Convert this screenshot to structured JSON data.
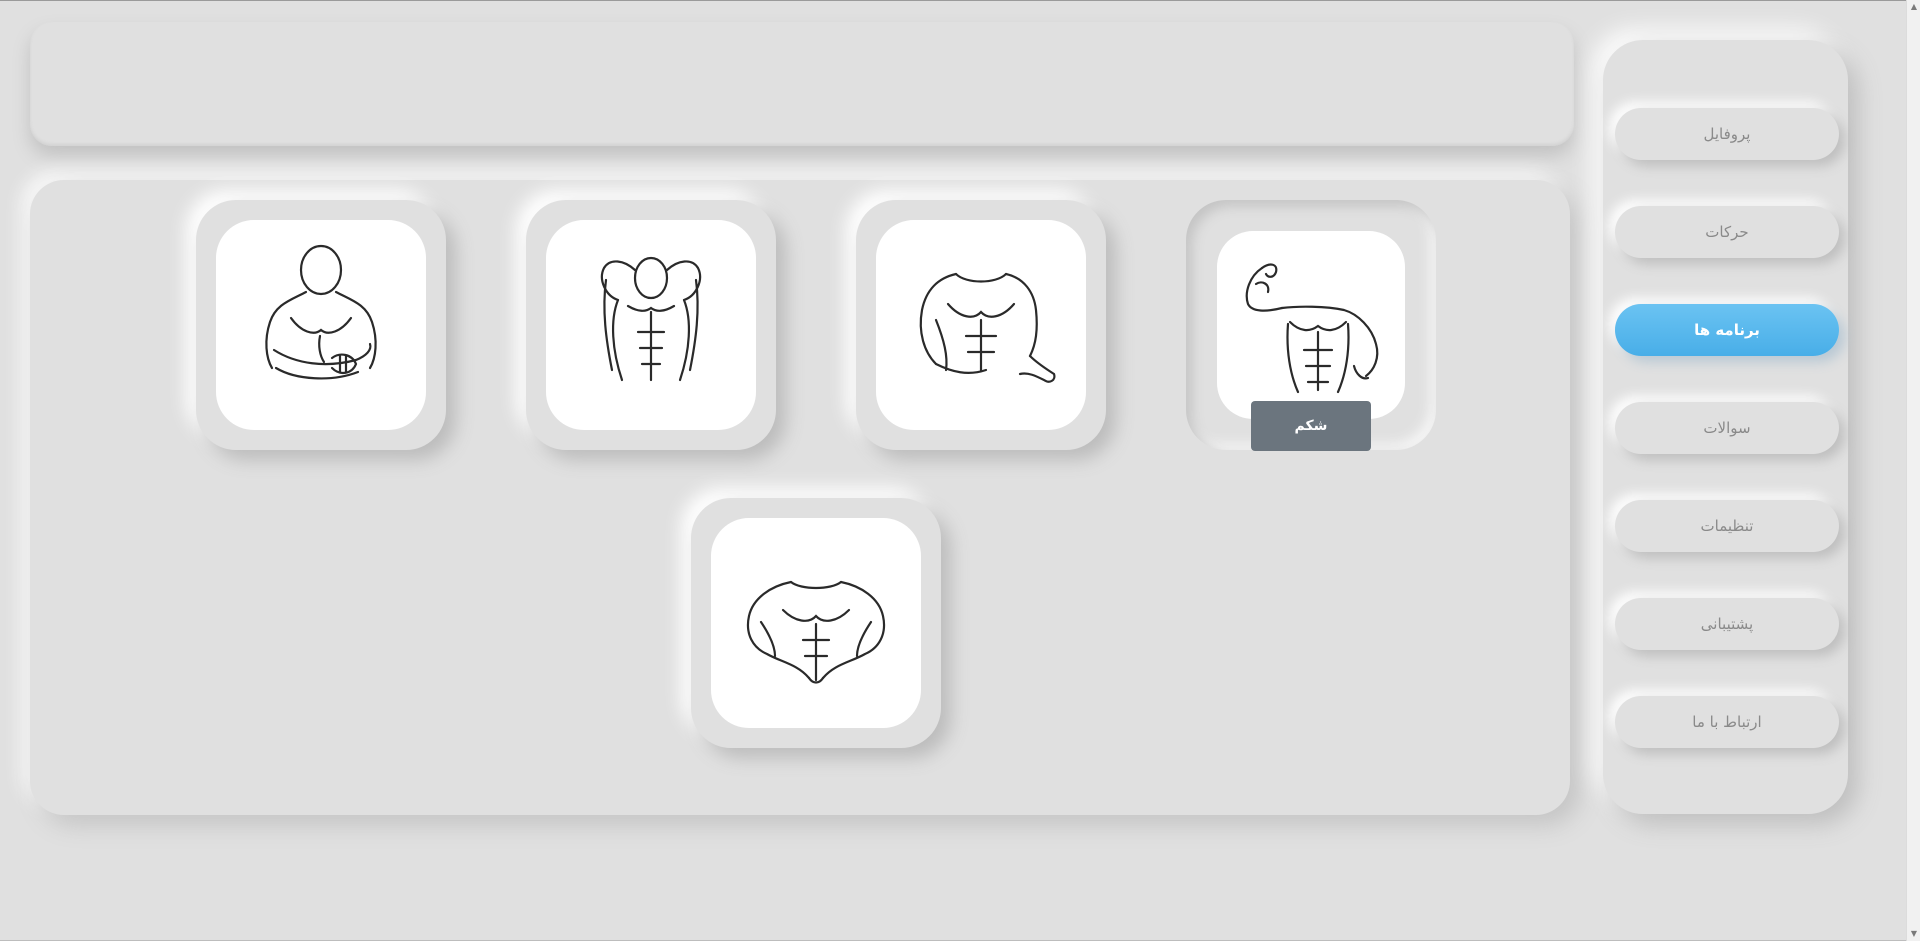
{
  "sidebar": {
    "items": [
      {
        "label": "پروفایل",
        "active": false
      },
      {
        "label": "حرکات",
        "active": false
      },
      {
        "label": "برنامه ها",
        "active": true
      },
      {
        "label": "سوالات",
        "active": false
      },
      {
        "label": "تنظیمات",
        "active": false
      },
      {
        "label": "پشتیبانی",
        "active": false
      },
      {
        "label": "ارتباط با ما",
        "active": false
      }
    ]
  },
  "cards": [
    {
      "icon": "bodybuilder-arms-crossed-icon",
      "label": ""
    },
    {
      "icon": "bodybuilder-back-pose-icon",
      "label": ""
    },
    {
      "icon": "bodybuilder-torso-icon",
      "label": ""
    },
    {
      "icon": "bodybuilder-biceps-flex-icon",
      "label": "شکم"
    },
    {
      "icon": "bodybuilder-chest-lats-icon",
      "label": ""
    }
  ],
  "colors": {
    "background": "#e0e0e0",
    "accent": "#48aee8",
    "label_bg": "#6b757e"
  }
}
